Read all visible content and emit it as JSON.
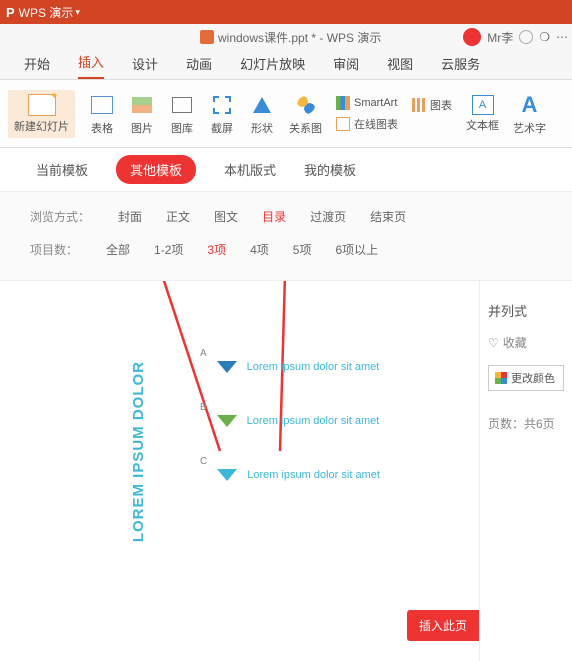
{
  "titlebar": {
    "app": "WPS 演示"
  },
  "doctab": {
    "filename": "windows课件.ppt * - WPS 演示",
    "user": "Mr李"
  },
  "menu": {
    "items": [
      "开始",
      "插入",
      "设计",
      "动画",
      "幻灯片放映",
      "审阅",
      "视图",
      "云服务"
    ],
    "active": 1
  },
  "ribbon": {
    "newslide": "新建幻灯片",
    "table": "表格",
    "picture": "图片",
    "gallery": "图库",
    "screenshot": "截屏",
    "shapes": "形状",
    "relation": "关系图",
    "smartart": "SmartArt",
    "chart": "图表",
    "onlinechart": "在线图表",
    "textbox": "文本框",
    "wordart": "艺术字"
  },
  "tabs": {
    "current": "当前模板",
    "other": "其他模板",
    "local": "本机版式",
    "mine": "我的模板"
  },
  "filters": {
    "browse_lbl": "浏览方式：",
    "browse": [
      "封面",
      "正文",
      "图文",
      "目录",
      "过渡页",
      "结束页"
    ],
    "browse_sel": 3,
    "count_lbl": "项目数：",
    "count": [
      "全部",
      "1-2项",
      "3项",
      "4项",
      "5项",
      "6项以上"
    ],
    "count_sel": 2
  },
  "slide": {
    "vtitle": "LOREM IPSUM DOLOR",
    "items": [
      {
        "letter": "A",
        "text": "Lorem ipsum dolor sit amet"
      },
      {
        "letter": "B",
        "text": "Lorem ipsum dolor sit amet"
      },
      {
        "letter": "C",
        "text": "Lorem ipsum dolor sit amet"
      }
    ],
    "insert": "插入此页"
  },
  "side": {
    "style": "并列式",
    "fav": "收藏",
    "changecolor": "更改颜色",
    "pages": "页数：共6页"
  }
}
